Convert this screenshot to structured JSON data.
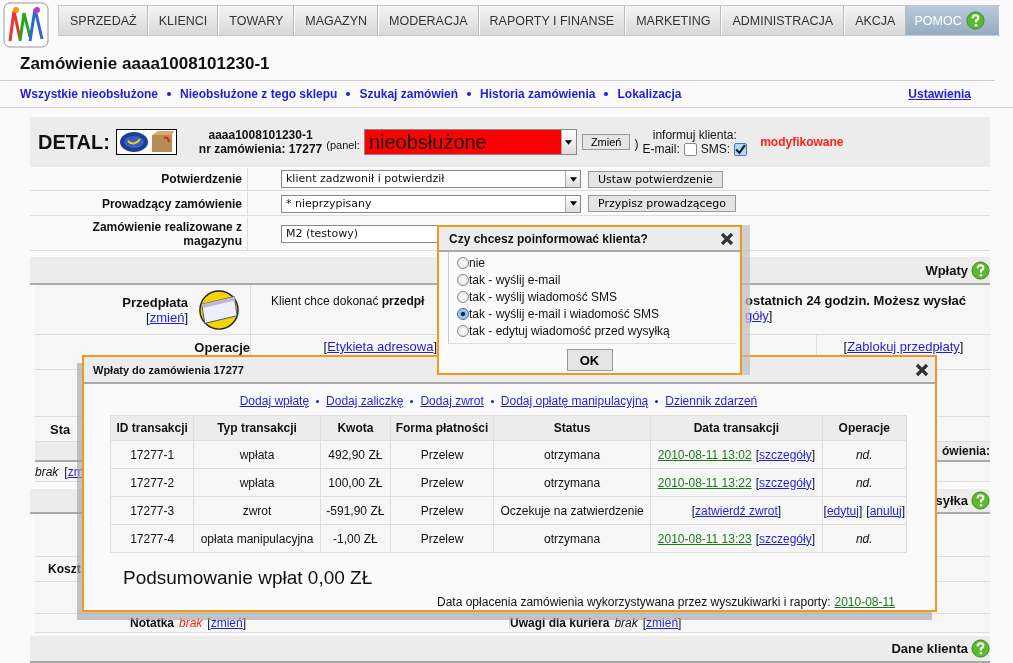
{
  "nav": [
    {
      "label": "SPRZEDAŻ",
      "selected": false
    },
    {
      "label": "KLIENCI",
      "selected": false
    },
    {
      "label": "TOWARY",
      "selected": false
    },
    {
      "label": "MAGAZYN",
      "selected": false
    },
    {
      "label": "MODERACJA",
      "selected": false
    },
    {
      "label": "RAPORTY I FINANSE",
      "selected": false
    },
    {
      "label": "MARKETING",
      "selected": false
    },
    {
      "label": "ADMINISTRACJA",
      "selected": false
    },
    {
      "label": "AKCJA",
      "selected": false
    },
    {
      "label": "POMOC",
      "selected": true
    }
  ],
  "page_title": "Zamówienie aaaa1008101230-1",
  "links": [
    "Wszystkie nieobsłużone",
    "Nieobsłużone z tego sklepu",
    "Szukaj zamówień",
    "Historia zamówienia",
    "Lokalizacja"
  ],
  "settings_link": "Ustawienia",
  "detail": {
    "label": "DETAL:",
    "code": "aaaa1008101230-1",
    "order_number": "nr zamówienia: 17277",
    "panel_label": "(panel:",
    "status": "nieobsłużone",
    "change_button": "Zmień",
    "paren": ")",
    "inform_label": "informuj klienta:",
    "email_label": "E-mail:",
    "email_checked": false,
    "sms_label": "SMS:",
    "sms_checked": true,
    "modified": "modyfikowane"
  },
  "form_rows": [
    {
      "label": "Potwierdzenie",
      "value": "klient zadzwonił i potwierdził",
      "button": "Ustaw potwierdzenie"
    },
    {
      "label": "Prowadzący zamówienie",
      "value": "* nieprzypisany",
      "button": "Przypisz prowadzącego"
    },
    {
      "label": "Zamówienie realizowane z magazynu",
      "value": "M2 (testowy)"
    }
  ],
  "payments_section": {
    "title": "Wpłaty",
    "prepayment_label": "Przedpłata",
    "change_link": {
      "pre": "[",
      "text": "zmień",
      "post": "]"
    },
    "text_left": "Klient chce dokonać **przedpł**",
    "text_right": "ostatnich 24 godzin. Możesz wysłać",
    "details_fragment": {
      "text": "góły",
      "post": "]"
    },
    "operations_label": "Operacje",
    "label_link": {
      "pre": "[",
      "text": "Etykieta adresowa",
      "post": "]"
    },
    "block_link": {
      "pre": "[",
      "text": "Zablokuj przedpłaty",
      "post": "]"
    },
    "status_fragment": "Sta"
  },
  "order_fragment": "ówienia:",
  "note_fragment": {
    "value": "brak",
    "link": {
      "pre": "[",
      "text": "zm"
    }
  },
  "shipping_fragment": "syłka",
  "cost_fragment": "Koszt",
  "notes": [
    {
      "label": "Notatka",
      "value": "brak",
      "link": {
        "pre": "[",
        "text": "zmień",
        "post": "]"
      }
    },
    {
      "label": "Uwagi dla kuriera",
      "value": "brak",
      "link": {
        "pre": "[",
        "text": "zmień",
        "post": "]"
      }
    }
  ],
  "client_section": "Dane klienta",
  "payments_dialog": {
    "title": "Wpłaty do zamówienia 17277",
    "links": [
      "Dodaj wpłatę",
      "Dodaj zaliczkę",
      "Dodaj zwrot",
      "Dodaj opłatę manipulacyjną",
      "Dziennik zdarzeń"
    ],
    "columns": [
      "ID transakcji",
      "Typ transakcji",
      "Kwota",
      "Forma płatności",
      "Status",
      "Data transakcji",
      "Operacje"
    ],
    "rows": [
      {
        "id": "17277-1",
        "type": "wpłata",
        "amount": "492,90 ZŁ",
        "method": "Przelew",
        "status": "otrzymana",
        "date": [
          {
            "kind": "date",
            "text": "2010-08-11 13:02"
          },
          {
            "kind": "link",
            "pre": "[",
            "text": "szczegóły",
            "post": "]"
          }
        ],
        "ops": [
          {
            "kind": "italic",
            "text": "nd."
          }
        ]
      },
      {
        "id": "17277-2",
        "type": "wpłata",
        "amount": "100,00 ZŁ",
        "method": "Przelew",
        "status": "otrzymana",
        "date": [
          {
            "kind": "date",
            "text": "2010-08-11 13:22"
          },
          {
            "kind": "link",
            "pre": "[",
            "text": "szczegóły",
            "post": "]"
          }
        ],
        "ops": [
          {
            "kind": "italic",
            "text": "nd."
          }
        ]
      },
      {
        "id": "17277-3",
        "type": "zwrot",
        "amount": "-591,90 ZŁ",
        "method": "Przelew",
        "status": "Oczekuje na zatwierdzenie",
        "date": [
          {
            "kind": "link",
            "pre": "[",
            "text": "zatwierdź zwrot",
            "post": "]"
          }
        ],
        "ops": [
          {
            "kind": "link",
            "pre": "[",
            "text": "edytuj",
            "post": "]"
          },
          {
            "kind": "link",
            "pre": "[",
            "text": "anuluj",
            "post": "]"
          }
        ]
      },
      {
        "id": "17277-4",
        "type": "opłata manipulacyjna",
        "amount": "-1,00 ZŁ",
        "method": "Przelew",
        "status": "otrzymana",
        "date": [
          {
            "kind": "date",
            "text": "2010-08-11 13:23"
          },
          {
            "kind": "link",
            "pre": "[",
            "text": "szczegóły",
            "post": "]"
          }
        ],
        "ops": [
          {
            "kind": "italic",
            "text": "nd."
          }
        ]
      }
    ],
    "summary": "Podsumowanie wpłat 0,00 ZŁ",
    "footer_text": "Data opłacenia zamówienia wykorzystywana przez wyszukiwarki i raporty:",
    "footer_date": "2010-08-11"
  },
  "inform_dialog": {
    "title": "Czy chcesz poinformować klienta?",
    "options": [
      {
        "label": "nie",
        "selected": false
      },
      {
        "label": "tak - wyślij e-mail",
        "selected": false
      },
      {
        "label": "tak - wyślij wiadomość SMS",
        "selected": false
      },
      {
        "label": "tak - wyślij e-mail i wiadomość SMS",
        "selected": true
      },
      {
        "label": "tak - edytuj wiadomość przed wysyłką",
        "selected": false
      }
    ],
    "ok": "OK"
  }
}
